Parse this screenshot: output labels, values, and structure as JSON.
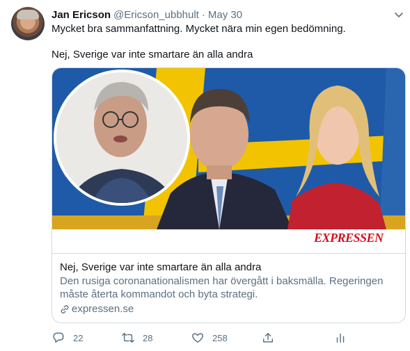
{
  "tweet": {
    "author_name": "Jan Ericson",
    "author_handle": "@Ericson_ubbhult",
    "separator": "·",
    "date": "May 30",
    "text_line1": "Mycket bra sammanfattning. Mycket nära min egen bedömning.",
    "text_line2": "Nej, Sverige var inte smartare än alla andra"
  },
  "card": {
    "brand": "EXPRESSEN",
    "title": "Nej, Sverige var inte smartare än alla andra",
    "description_line1": "Den rusiga coronanationalismen har övergått i baksmälla. Regeringen",
    "description_line2": "måste återta kommandot och byta strategi.",
    "domain": "expressen.se"
  },
  "actions": {
    "replies": "22",
    "retweets": "28",
    "likes": "258"
  },
  "icons": {
    "caret": "chevron-down-icon",
    "reply": "reply-icon",
    "retweet": "retweet-icon",
    "like": "heart-icon",
    "share": "share-icon",
    "analytics": "analytics-icon",
    "link": "link-icon"
  },
  "colors": {
    "text_primary": "#0f1419",
    "text_secondary": "#5b7083",
    "border": "#cfd9de",
    "brand_red": "#d40f1e",
    "flag_blue": "#1e5aa8",
    "flag_yellow": "#f2c300"
  }
}
